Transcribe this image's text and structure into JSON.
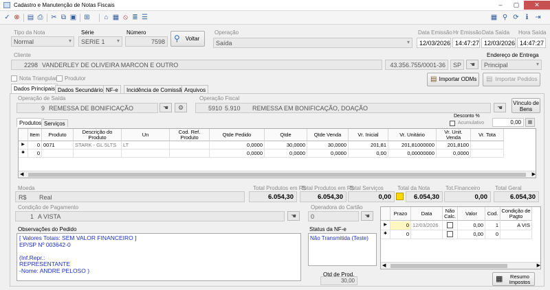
{
  "window": {
    "title": "Cadastro e Manutenção de Notas Fiscais"
  },
  "header": {
    "tipo_label": "Tipo da Nota",
    "tipo_value": "Normal",
    "serie_label": "Série",
    "serie_value": "SERIE 1",
    "numero_label": "Número",
    "numero_value": "7598",
    "voltar_label": "Voltar",
    "operacao_label": "Operação",
    "operacao_value": "Saída",
    "data_emissao_label": "Data Emissão",
    "data_emissao_value": "12/03/2026",
    "hr_emissao_label": "Hr Emissão",
    "hr_emissao_value": "14:47:27",
    "data_saida_label": "Data Saída",
    "data_saida_value": "12/03/2026",
    "hora_saida_label": "Hora Saída",
    "hora_saida_value": "14:47:27"
  },
  "cliente": {
    "label": "Cliente",
    "code": "2298",
    "name": "VANDERLEY DE OLIVEIRA MARCON E OUTRO",
    "doc": "43.356.755/0001-36",
    "uf": "SP",
    "endereco_label": "Endereço de Entrega",
    "endereco_value": "Principal"
  },
  "flags": {
    "nota_triangular": "Nota Triangular",
    "produtor": "Produtor"
  },
  "actions": {
    "importar_odms": "Importar ODMs",
    "importar_pedidos": "Importar Pedidos"
  },
  "tabs": [
    "Dados Principais",
    "Dados Secundários",
    "NF-e",
    "Incidência de Comissão",
    "Arquivos"
  ],
  "operacao_saida": {
    "label": "Operação de Saída",
    "code": "9",
    "name": "REMESSA DE BONIFICAÇÃO"
  },
  "operacao_fiscal": {
    "label": "Operação Fiscal",
    "code": "5910",
    "sub": "5.910",
    "name": "REMESSA EM BONIFICAÇÃO, DOAÇÃO"
  },
  "vinculo": "Vínculo de Bens",
  "desconto": {
    "label": "Desconto %",
    "acumulativo": "Acumulativo",
    "value": "0,00"
  },
  "subtabs": [
    "Produtos",
    "Serviços"
  ],
  "products": {
    "headers": [
      "Item",
      "Produto",
      "Descrição do Produto",
      "Un",
      "Cod. Ref. Produto",
      "Qtde Pedido",
      "Qtde",
      "Qtde Venda",
      "Vr. Inicial",
      "Vr. Unitário",
      "Vr. Unit. Venda",
      "Vr. Tota"
    ],
    "rows": [
      [
        "0",
        "0071",
        "STARK - GL 5LTS",
        "LT",
        "",
        "0,0000",
        "30,0000",
        "30,0000",
        "201,81",
        "201,81000000",
        "201,8100",
        ""
      ],
      [
        "0",
        "",
        "",
        "",
        "",
        "0,0000",
        "0,0000",
        "0,0000",
        "0,00",
        "0,00000000",
        "0,0000",
        ""
      ]
    ]
  },
  "moeda": {
    "label": "Moeda",
    "code": "R$",
    "name": "Real"
  },
  "totals": {
    "tp_label": "Total Produtos em R$",
    "tp_value": "6.054,30",
    "tpr_label": "Total Produtos em R$",
    "tpr_value": "6.054,30",
    "ts_label": "Total Serviços",
    "ts_value": "0,00",
    "tn_label": "Total da Nota",
    "tn_value": "6.054,30",
    "tf_label": "Tot.Financeiro",
    "tf_value": "0,00",
    "tg_label": "Total Geral",
    "tg_value": "6.054,30"
  },
  "pagamento": {
    "label": "Condição de Pagamento",
    "code": "1",
    "name": "A VISTA"
  },
  "cartao": {
    "label": "Operadora do Cartão",
    "value": "0"
  },
  "parcelas": {
    "headers": [
      "Prazo",
      "Data",
      "Não Calc.",
      "Valor",
      "Cod.",
      "Condição de Pagto"
    ],
    "rows": [
      [
        "0",
        "12/03/2026",
        "",
        "0,00",
        "1",
        "A VIS"
      ],
      [
        "0",
        "",
        "",
        "0,00",
        "0",
        ""
      ]
    ]
  },
  "obs": {
    "label": "Observações do Pedido",
    "lines": [
      "[ Valores Totais: SEM VALOR FINANCEIRO ]",
      "EP/SP Nº 003642-0",
      "",
      "(Inf.Repr.:",
      "REPRESENTANTE",
      "-Nome: ANDRE PELOSO )"
    ]
  },
  "status": {
    "label": "Status da NF-e",
    "value": "Não Transmitida (Teste)"
  },
  "qtd": {
    "label": "Qtd de Prod.",
    "value": "30,00"
  },
  "resumo": "Resumo Impostos",
  "colors": {
    "accent": "#1a2fc7",
    "selected_cell": "#ffd800"
  }
}
